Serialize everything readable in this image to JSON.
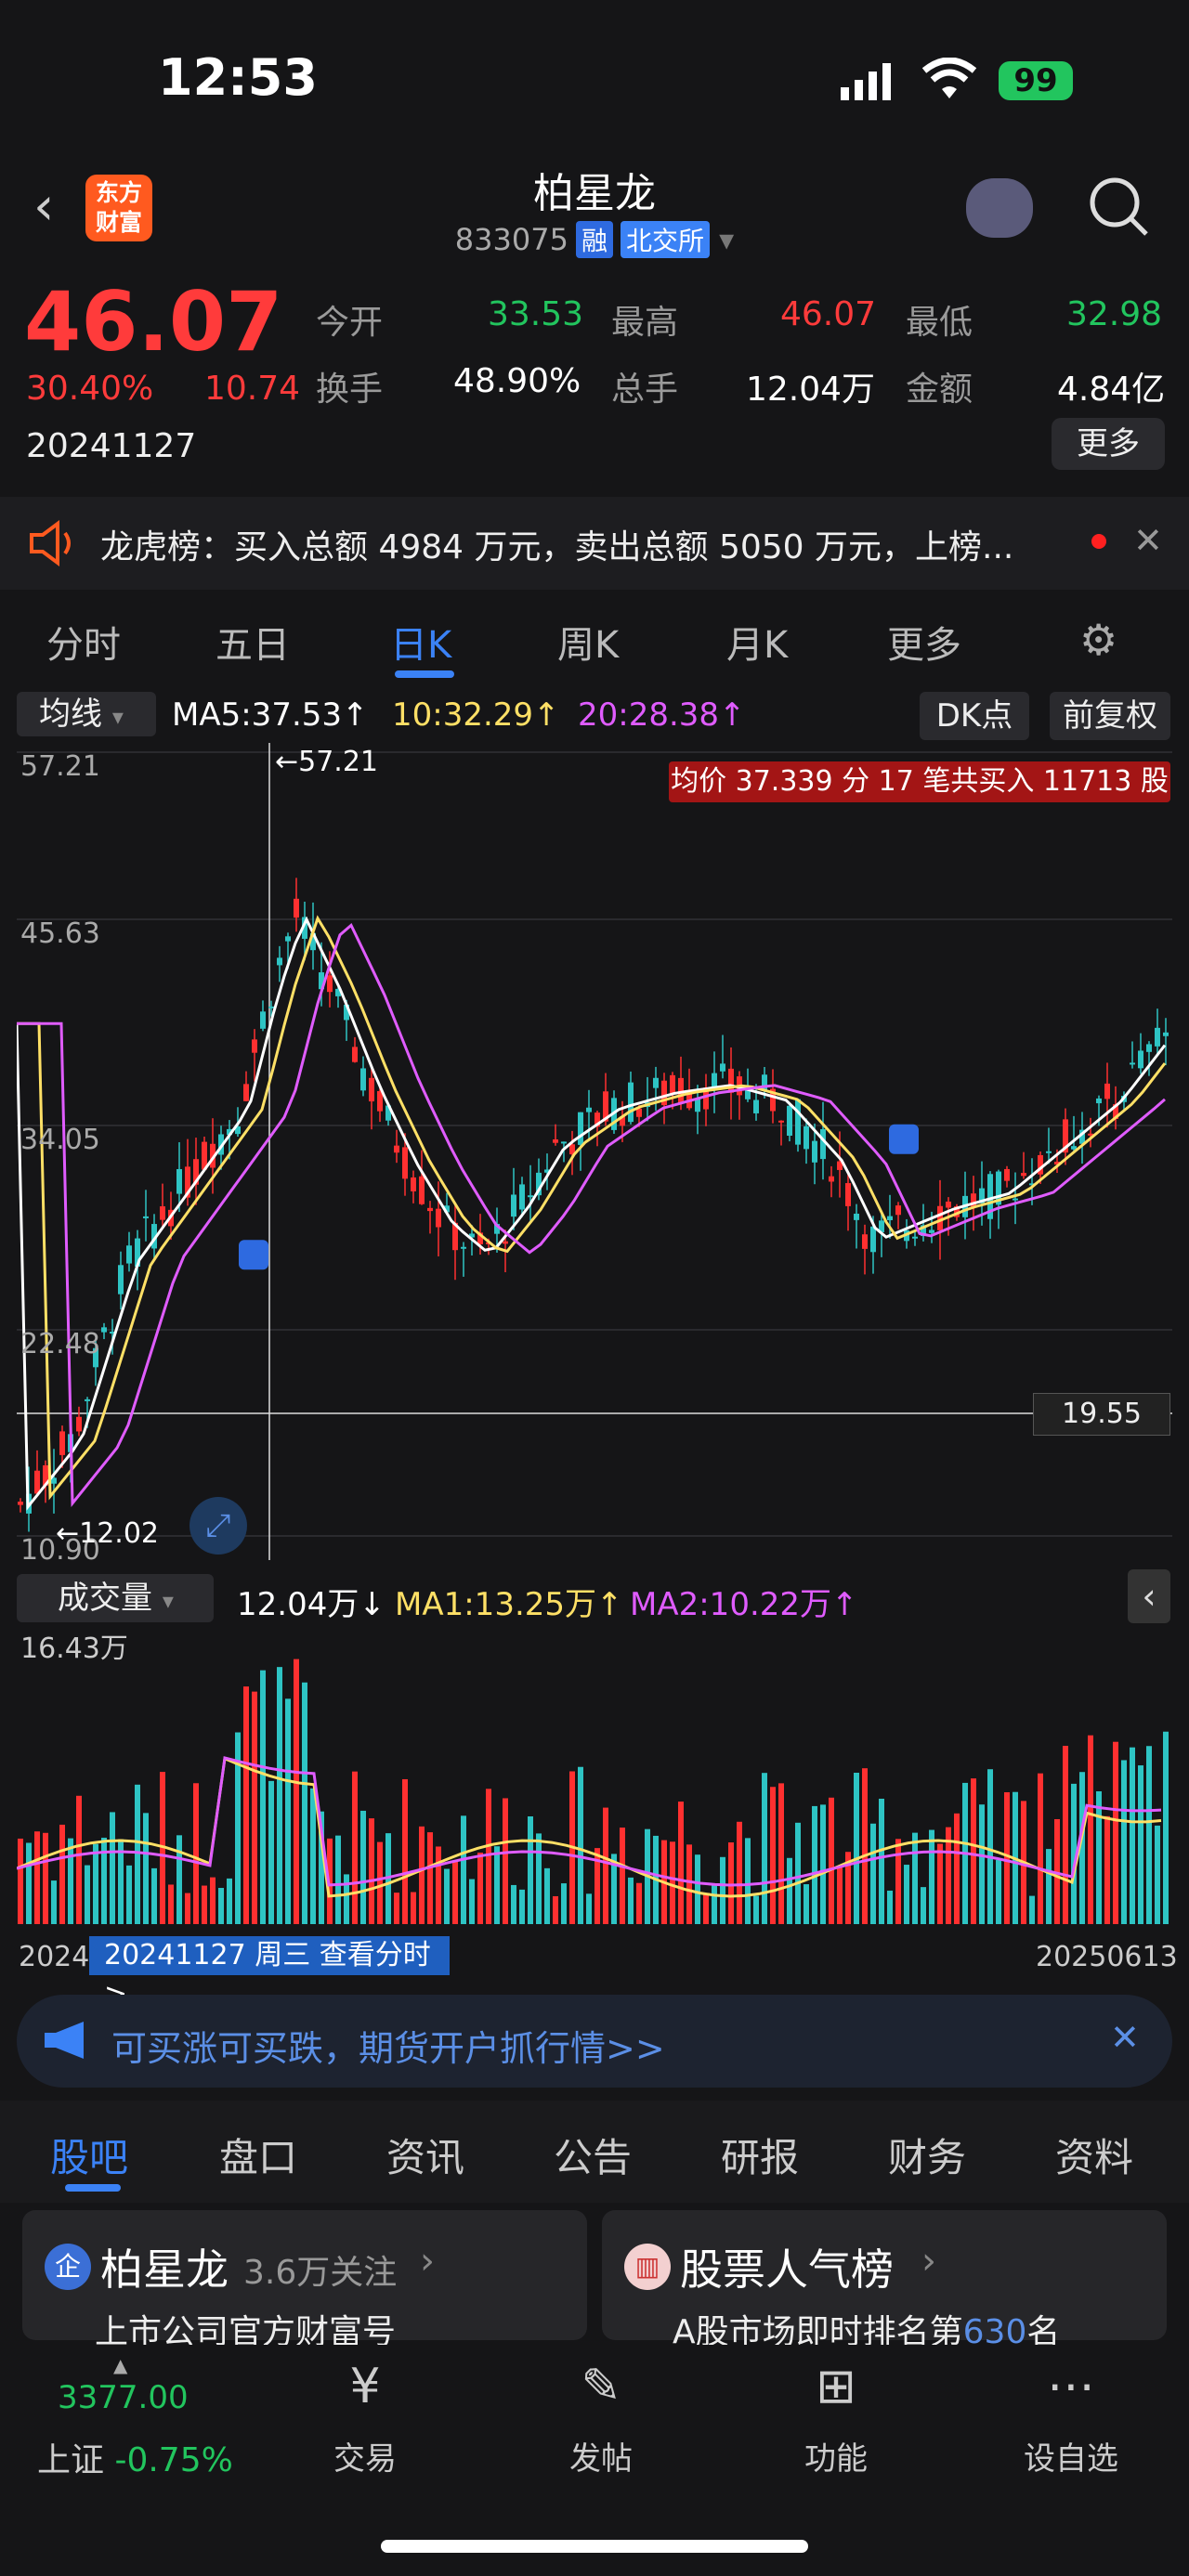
{
  "status_bar": {
    "time": "12:53",
    "battery": "99"
  },
  "nav": {
    "logo_text": "东方财富",
    "title": "柏星龙",
    "code": "833075",
    "tag_rong": "融",
    "tag_exchange": "北交所"
  },
  "quote": {
    "price": "46.07",
    "change_pct": "30.40%",
    "change_amt": "10.74",
    "date": "20241127",
    "open_label": "今开",
    "open": "33.53",
    "high_label": "最高",
    "high": "46.07",
    "low_label": "最低",
    "low": "32.98",
    "turnover_label": "换手",
    "turnover": "48.90%",
    "volume_label": "总手",
    "volume": "12.04万",
    "amount_label": "金额",
    "amount": "4.84亿",
    "more": "更多"
  },
  "banner": {
    "text": "龙虎榜：买入总额 4984 万元，卖出总额 5050 万元，上榜..."
  },
  "tabs": [
    "分时",
    "五日",
    "日K",
    "周K",
    "月K",
    "更多"
  ],
  "indicators": {
    "ma_select": "均线",
    "ma5": "MA5:37.53↑",
    "ma10": "10:32.29↑",
    "ma20": "20:28.38↑",
    "dk": "DK点",
    "fq": "前复权",
    "avg_note": "均价 37.339 分 17 笔共买入 11713 股"
  },
  "chart_data": {
    "type": "candlestick",
    "y_axis_ticks": [
      "57.21",
      "45.63",
      "34.05",
      "22.48",
      "10.90"
    ],
    "high_marker": "←57.21",
    "low_marker": "←12.02",
    "crosshair_value": "19.55",
    "ylim": [
      10.9,
      57.21
    ],
    "volume": {
      "select": "成交量",
      "value": "12.04万↓",
      "ma1": "MA1:13.25万↑",
      "ma2": "MA2:10.22万↑",
      "max_tick": "16.43万"
    },
    "x_start": "2024",
    "x_end": "20250613",
    "selected_date": "20241127 周三 查看分时 >"
  },
  "ad": {
    "text": "可买涨可买跌，期货开户抓行情>>"
  },
  "bottom_tabs": [
    "股吧",
    "盘口",
    "资讯",
    "公告",
    "研报",
    "财务",
    "资料"
  ],
  "cards": {
    "left_title": "柏星龙",
    "left_follow": "3.6万关注",
    "left_sub": "上市公司官方财富号",
    "right_title": "股票人气榜",
    "right_sub_pre": "A股市场即时排名第",
    "right_rank": "630",
    "right_sub_post": "名"
  },
  "bottom_nav": {
    "index_value": "3377.00",
    "index_label": "上证",
    "index_change": "-0.75%",
    "trade": "交易",
    "post": "发帖",
    "func": "功能",
    "watch": "设自选"
  },
  "colors": {
    "up": "#ff3b3b",
    "down": "#22c55e",
    "accent": "#3b82f6"
  }
}
